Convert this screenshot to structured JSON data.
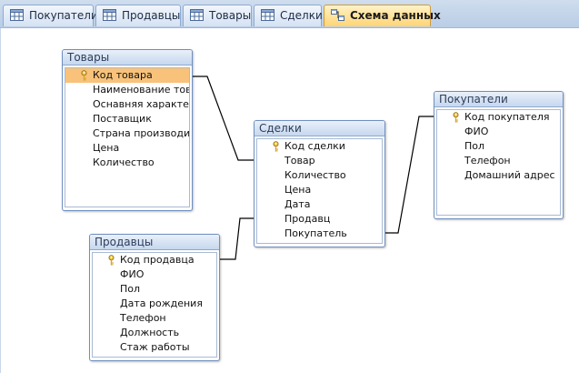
{
  "tabs": [
    {
      "label": "Покупатели",
      "active": false,
      "icon": "table-icon"
    },
    {
      "label": "Продавцы",
      "active": false,
      "icon": "table-icon"
    },
    {
      "label": "Товары",
      "active": false,
      "icon": "table-icon"
    },
    {
      "label": "Сделки",
      "active": false,
      "icon": "table-icon"
    },
    {
      "label": "Схема данных",
      "active": true,
      "icon": "relationships-icon"
    }
  ],
  "tables": {
    "tovary": {
      "title": "Товары",
      "fields": [
        "Код товара",
        "Наименование това",
        "Оснавняя характер",
        "Поставщик",
        "Страна производит",
        "Цена",
        "Количество"
      ],
      "key_field": "Код товара",
      "selected_field": "Код товара"
    },
    "sdelki": {
      "title": "Сделки",
      "fields": [
        "Код сделки",
        "Товар",
        "Количество",
        "Цена",
        "Дата",
        "Продавц",
        "Покупатель"
      ],
      "key_field": "Код сделки"
    },
    "pokupateli": {
      "title": "Покупатели",
      "fields": [
        "Код покупателя",
        "ФИО",
        "Пол",
        "Телефон",
        "Домашний адрес"
      ],
      "key_field": "Код покупателя"
    },
    "prodavcy": {
      "title": "Продавцы",
      "fields": [
        "Код продавца",
        "ФИО",
        "Пол",
        "Дата рождения",
        "Телефон",
        "Должность",
        "Стаж работы"
      ],
      "key_field": "Код продавца"
    }
  },
  "colors": {
    "active_tab": "#ffd474",
    "selected_field": "#f8c27a",
    "window_border": "#6f8fbf",
    "link_line": "#000000"
  }
}
